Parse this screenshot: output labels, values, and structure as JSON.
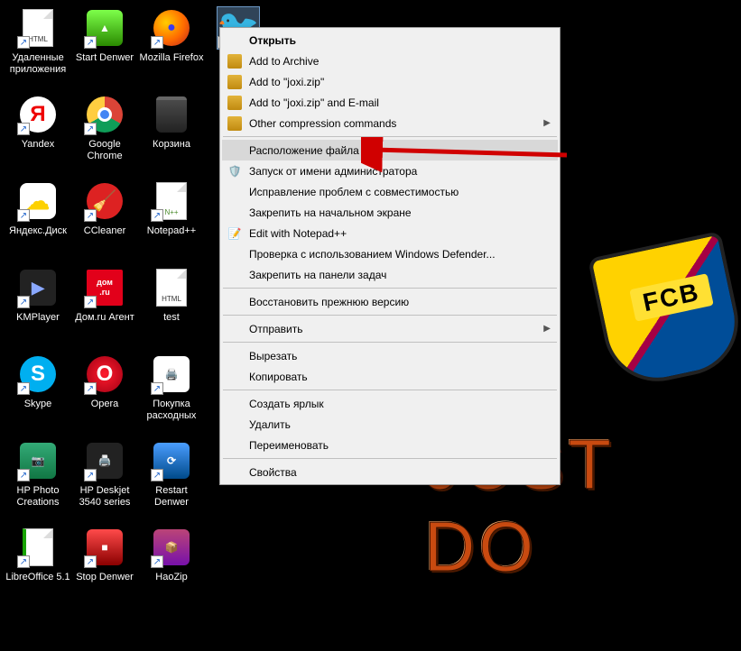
{
  "wallpaper": {
    "fcb_text": "FCB",
    "slogan": "JUST DO"
  },
  "selected_icon_name": "joxi",
  "desktop_icons": [
    {
      "label": "Удаленные приложения",
      "type": "file-html",
      "shortcut": true
    },
    {
      "label": "Start Denwer",
      "type": "denwer-green",
      "shortcut": true
    },
    {
      "label": "Mozilla Firefox",
      "type": "firefox",
      "shortcut": true
    },
    {
      "label": "",
      "type": "bird",
      "shortcut": true,
      "selected": true
    },
    {
      "label": "Yandex",
      "type": "yandex",
      "shortcut": true
    },
    {
      "label": "Google Chrome",
      "type": "chrome",
      "shortcut": true
    },
    {
      "label": "Корзина",
      "type": "recycle-bin",
      "shortcut": false
    },
    {
      "label": "",
      "type": "empty"
    },
    {
      "label": "Яндекс.Диск",
      "type": "yadisk",
      "shortcut": true
    },
    {
      "label": "CCleaner",
      "type": "ccleaner",
      "shortcut": true
    },
    {
      "label": "Notepad++",
      "type": "notepadpp",
      "shortcut": true
    },
    {
      "label": "",
      "type": "empty"
    },
    {
      "label": "KMPlayer",
      "type": "kmplayer",
      "shortcut": true
    },
    {
      "label": "Дом.ru Агент",
      "type": "domru",
      "shortcut": true
    },
    {
      "label": "test",
      "type": "file-html",
      "shortcut": false
    },
    {
      "label": "",
      "type": "empty"
    },
    {
      "label": "Skype",
      "type": "skype",
      "shortcut": true
    },
    {
      "label": "Opera",
      "type": "opera",
      "shortcut": true
    },
    {
      "label": "Покупка расходных",
      "type": "printer",
      "shortcut": true
    },
    {
      "label": "",
      "type": "empty"
    },
    {
      "label": "HP Photo Creations",
      "type": "hpphoto",
      "shortcut": true
    },
    {
      "label": "HP Deskjet 3540 series",
      "type": "hpprinter",
      "shortcut": true
    },
    {
      "label": "Restart Denwer",
      "type": "denwer-blue",
      "shortcut": true
    },
    {
      "label": "",
      "type": "empty"
    },
    {
      "label": "LibreOffice 5.1",
      "type": "libreoffice",
      "shortcut": true
    },
    {
      "label": "Stop Denwer",
      "type": "denwer-red",
      "shortcut": true
    },
    {
      "label": "HaoZip",
      "type": "haozip",
      "shortcut": true
    },
    {
      "label": "",
      "type": "empty"
    }
  ],
  "context_menu": [
    {
      "label": "Открыть",
      "bold": true
    },
    {
      "label": "Add to Archive",
      "icon": "hz"
    },
    {
      "label": "Add to \"joxi.zip\"",
      "icon": "hz"
    },
    {
      "label": "Add to \"joxi.zip\" and E-mail",
      "icon": "hz"
    },
    {
      "label": "Other compression commands",
      "icon": "hz",
      "submenu": true
    },
    {
      "sep": true
    },
    {
      "label": "Расположение файла",
      "highlight": true
    },
    {
      "label": "Запуск от имени администратора",
      "icon": "shield"
    },
    {
      "label": "Исправление проблем с совместимостью"
    },
    {
      "label": "Закрепить на начальном экране"
    },
    {
      "label": "Edit with Notepad++",
      "icon": "npp"
    },
    {
      "label": "Проверка с использованием Windows Defender..."
    },
    {
      "label": "Закрепить на панели задач"
    },
    {
      "sep": true
    },
    {
      "label": "Восстановить прежнюю версию"
    },
    {
      "sep": true
    },
    {
      "label": "Отправить",
      "submenu": true
    },
    {
      "sep": true
    },
    {
      "label": "Вырезать"
    },
    {
      "label": "Копировать"
    },
    {
      "sep": true
    },
    {
      "label": "Создать ярлык"
    },
    {
      "label": "Удалить"
    },
    {
      "label": "Переименовать"
    },
    {
      "sep": true
    },
    {
      "label": "Свойства"
    }
  ]
}
